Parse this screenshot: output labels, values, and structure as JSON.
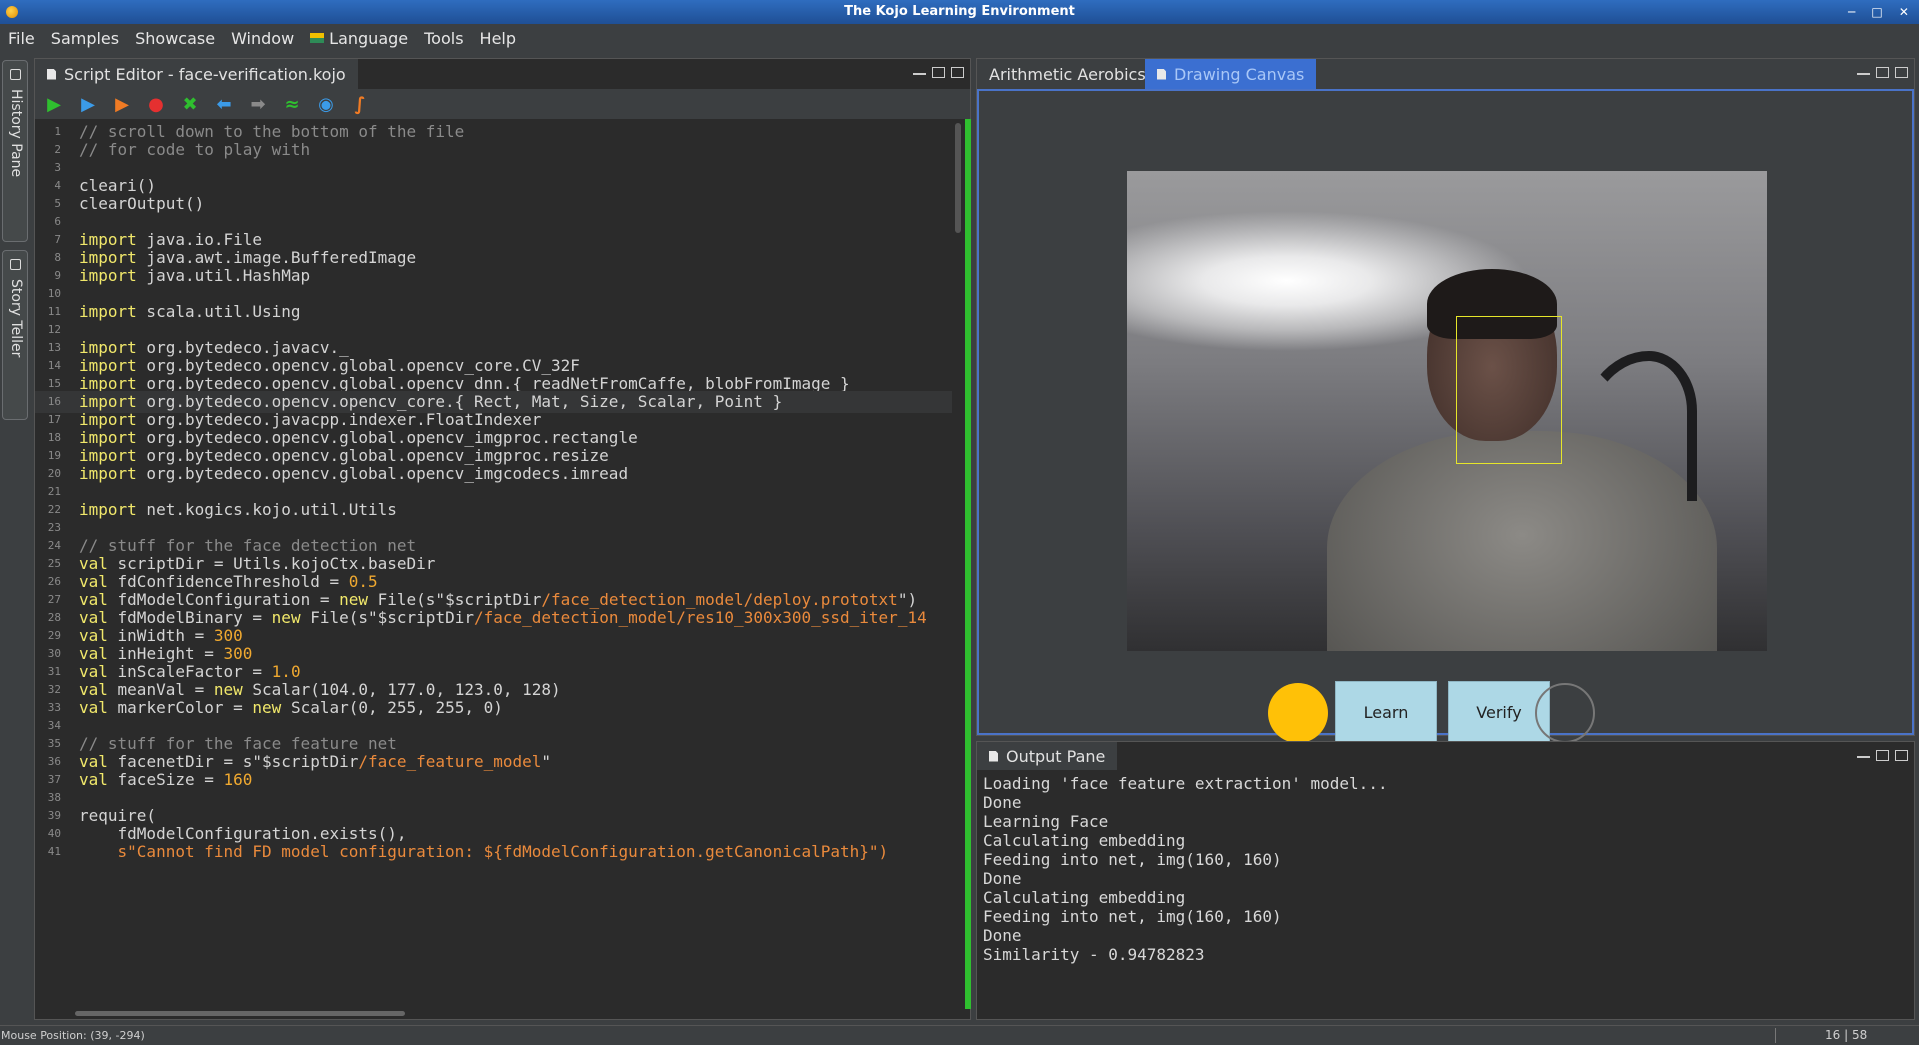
{
  "window": {
    "title": "The Kojo Learning Environment"
  },
  "menu": [
    "File",
    "Samples",
    "Showcase",
    "Window",
    "Language",
    "Tools",
    "Help"
  ],
  "left_dock": {
    "tabs": [
      "History Pane",
      "Story Teller"
    ]
  },
  "editor": {
    "tab_title": "Script Editor - face-verification.kojo",
    "toolbar_icons": [
      "run-icon",
      "run-worksheet-icon",
      "trace-icon",
      "stop-icon",
      "clear-icon",
      "undo-icon",
      "redo-icon",
      "format-icon",
      "check-icon",
      "share-icon"
    ],
    "lines": [
      {
        "n": "1",
        "segs": [
          {
            "t": "// scroll down to the bottom of the file",
            "c": "cm"
          }
        ]
      },
      {
        "n": "2",
        "segs": [
          {
            "t": "// for code to play with",
            "c": "cm"
          }
        ]
      },
      {
        "n": "3",
        "segs": []
      },
      {
        "n": "4",
        "segs": [
          {
            "t": "cleari()",
            "c": ""
          }
        ]
      },
      {
        "n": "5",
        "segs": [
          {
            "t": "clearOutput()",
            "c": ""
          }
        ]
      },
      {
        "n": "6",
        "segs": []
      },
      {
        "n": "7",
        "segs": [
          {
            "t": "import",
            "c": "kw"
          },
          {
            "t": " java.io.File",
            "c": ""
          }
        ]
      },
      {
        "n": "8",
        "segs": [
          {
            "t": "import",
            "c": "kw"
          },
          {
            "t": " java.awt.image.BufferedImage",
            "c": ""
          }
        ]
      },
      {
        "n": "9",
        "segs": [
          {
            "t": "import",
            "c": "kw"
          },
          {
            "t": " java.util.HashMap",
            "c": ""
          }
        ]
      },
      {
        "n": "10",
        "segs": []
      },
      {
        "n": "11",
        "segs": [
          {
            "t": "import",
            "c": "kw"
          },
          {
            "t": " scala.util.Using",
            "c": ""
          }
        ]
      },
      {
        "n": "12",
        "segs": []
      },
      {
        "n": "13",
        "segs": [
          {
            "t": "import",
            "c": "kw"
          },
          {
            "t": " org.bytedeco.javacv._",
            "c": ""
          }
        ]
      },
      {
        "n": "14",
        "segs": [
          {
            "t": "import",
            "c": "kw"
          },
          {
            "t": " org.bytedeco.opencv.global.opencv_core.CV_32F",
            "c": ""
          }
        ]
      },
      {
        "n": "15",
        "segs": [
          {
            "t": "import",
            "c": "kw"
          },
          {
            "t": " org.bytedeco.opencv.global.opencv_dnn.{ readNetFromCaffe, blobFromImage }",
            "c": ""
          }
        ]
      },
      {
        "n": "16",
        "segs": [
          {
            "t": "import",
            "c": "kw"
          },
          {
            "t": " org.bytedeco.opencv.opencv_core.{ Rect, Mat, Size, Scalar, Point }",
            "c": ""
          }
        ],
        "hl": true
      },
      {
        "n": "17",
        "segs": [
          {
            "t": "import",
            "c": "kw"
          },
          {
            "t": " org.bytedeco.javacpp.indexer.FloatIndexer",
            "c": ""
          }
        ]
      },
      {
        "n": "18",
        "segs": [
          {
            "t": "import",
            "c": "kw"
          },
          {
            "t": " org.bytedeco.opencv.global.opencv_imgproc.rectangle",
            "c": ""
          }
        ]
      },
      {
        "n": "19",
        "segs": [
          {
            "t": "import",
            "c": "kw"
          },
          {
            "t": " org.bytedeco.opencv.global.opencv_imgproc.resize",
            "c": ""
          }
        ]
      },
      {
        "n": "20",
        "segs": [
          {
            "t": "import",
            "c": "kw"
          },
          {
            "t": " org.bytedeco.opencv.global.opencv_imgcodecs.imread",
            "c": ""
          }
        ]
      },
      {
        "n": "21",
        "segs": []
      },
      {
        "n": "22",
        "segs": [
          {
            "t": "import",
            "c": "kw"
          },
          {
            "t": " net.kogics.kojo.util.Utils",
            "c": ""
          }
        ]
      },
      {
        "n": "23",
        "segs": []
      },
      {
        "n": "24",
        "segs": [
          {
            "t": "// stuff for the face detection net",
            "c": "cm"
          }
        ]
      },
      {
        "n": "25",
        "segs": [
          {
            "t": "val",
            "c": "kw"
          },
          {
            "t": " scriptDir = Utils.kojoCtx.baseDir",
            "c": ""
          }
        ]
      },
      {
        "n": "26",
        "segs": [
          {
            "t": "val",
            "c": "kw"
          },
          {
            "t": " fdConfidenceThreshold = ",
            "c": ""
          },
          {
            "t": "0.5",
            "c": "num"
          }
        ]
      },
      {
        "n": "27",
        "segs": [
          {
            "t": "val",
            "c": "kw"
          },
          {
            "t": " fdModelConfiguration = ",
            "c": ""
          },
          {
            "t": "new",
            "c": "kw"
          },
          {
            "t": " File(s\"$scriptDir",
            "c": ""
          },
          {
            "t": "/face_detection_model/deploy.prototxt",
            "c": "str"
          },
          {
            "t": "\")",
            "c": ""
          }
        ]
      },
      {
        "n": "28",
        "segs": [
          {
            "t": "val",
            "c": "kw"
          },
          {
            "t": " fdModelBinary = ",
            "c": ""
          },
          {
            "t": "new",
            "c": "kw"
          },
          {
            "t": " File(s\"$scriptDir",
            "c": ""
          },
          {
            "t": "/face_detection_model/res10_300x300_ssd_iter_14",
            "c": "str"
          }
        ]
      },
      {
        "n": "29",
        "segs": [
          {
            "t": "val",
            "c": "kw"
          },
          {
            "t": " inWidth = ",
            "c": ""
          },
          {
            "t": "300",
            "c": "num"
          }
        ]
      },
      {
        "n": "30",
        "segs": [
          {
            "t": "val",
            "c": "kw"
          },
          {
            "t": " inHeight = ",
            "c": ""
          },
          {
            "t": "300",
            "c": "num"
          }
        ]
      },
      {
        "n": "31",
        "segs": [
          {
            "t": "val",
            "c": "kw"
          },
          {
            "t": " inScaleFactor = ",
            "c": ""
          },
          {
            "t": "1.0",
            "c": "num"
          }
        ]
      },
      {
        "n": "32",
        "segs": [
          {
            "t": "val",
            "c": "kw"
          },
          {
            "t": " meanVal = ",
            "c": ""
          },
          {
            "t": "new",
            "c": "kw"
          },
          {
            "t": " Scalar(104.0, 177.0, 123.0, 128)",
            "c": ""
          }
        ]
      },
      {
        "n": "33",
        "segs": [
          {
            "t": "val",
            "c": "kw"
          },
          {
            "t": " markerColor = ",
            "c": ""
          },
          {
            "t": "new",
            "c": "kw"
          },
          {
            "t": " Scalar(0, 255, 255, 0)",
            "c": ""
          }
        ]
      },
      {
        "n": "34",
        "segs": []
      },
      {
        "n": "35",
        "segs": [
          {
            "t": "// stuff for the face feature net",
            "c": "cm"
          }
        ]
      },
      {
        "n": "36",
        "segs": [
          {
            "t": "val",
            "c": "kw"
          },
          {
            "t": " facenetDir = s\"$scriptDir",
            "c": ""
          },
          {
            "t": "/face_feature_model",
            "c": "str"
          },
          {
            "t": "\"",
            "c": ""
          }
        ]
      },
      {
        "n": "37",
        "segs": [
          {
            "t": "val",
            "c": "kw"
          },
          {
            "t": " faceSize = ",
            "c": ""
          },
          {
            "t": "160",
            "c": "num"
          }
        ]
      },
      {
        "n": "38",
        "segs": []
      },
      {
        "n": "39",
        "segs": [
          {
            "t": "require(",
            "c": ""
          }
        ]
      },
      {
        "n": "40",
        "segs": [
          {
            "t": "    fdModelConfiguration.exists(),",
            "c": ""
          }
        ]
      },
      {
        "n": "41",
        "segs": [
          {
            "t": "    s\"Cannot find FD model configuration: ${fdModelConfiguration.getCanonicalPath}\")",
            "c": "str"
          }
        ]
      }
    ]
  },
  "canvas_panel": {
    "tabs": [
      "Arithmetic Aerobics",
      "Drawing Canvas"
    ],
    "active_tab": "Drawing Canvas",
    "buttons": {
      "learn": "Learn",
      "verify": "Verify"
    },
    "colors": {
      "status_left": "#ffc107",
      "status_right": "#3c3f41",
      "button_bg": "#add8e6"
    }
  },
  "output": {
    "tab_title": "Output Pane",
    "lines": [
      "Loading 'face feature extraction' model...",
      "Done",
      "Learning Face",
      "Calculating embedding",
      "Feeding into net, img(160, 160)",
      "Done",
      "Calculating embedding",
      "Feeding into net, img(160, 160)",
      "Done",
      "Similarity - 0.94782823"
    ]
  },
  "status": {
    "mouse_position": "Mouse Position: (39, -294)",
    "caret": "16 | 58"
  }
}
